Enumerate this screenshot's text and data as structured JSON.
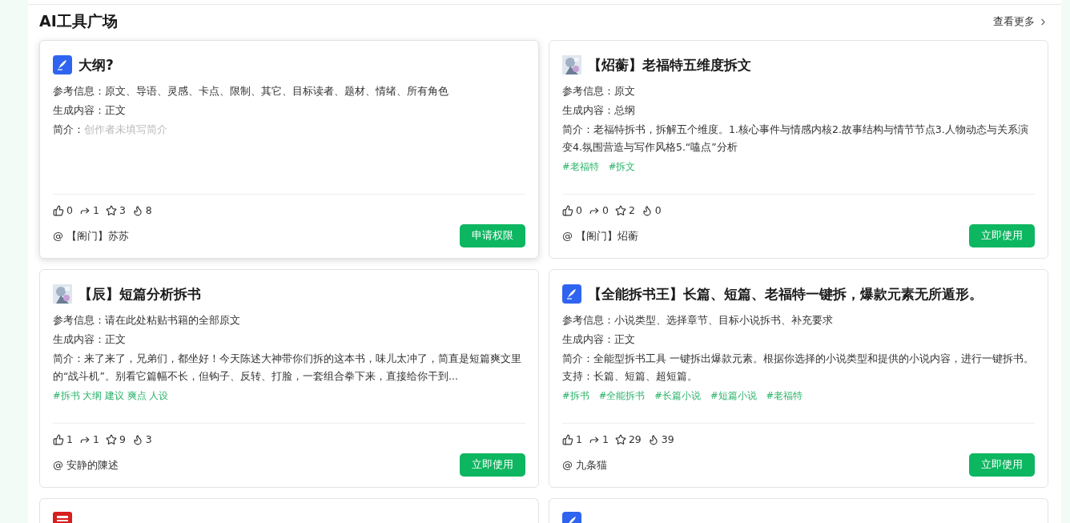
{
  "section": {
    "title": "AI工具广场",
    "more_link": "查看更多"
  },
  "cards": [
    {
      "kind": "quill",
      "raised": true,
      "title": "大纲?",
      "fields": [
        {
          "label": "参考信息：",
          "value": "原文、导语、灵感、卡点、限制、其它、目标读者、题材、情绪、所有角色",
          "empty": false
        },
        {
          "label": "生成内容：",
          "value": "正文",
          "empty": false
        },
        {
          "label": "简介：",
          "value": "创作者未填写简介",
          "empty": true
        }
      ],
      "stats": {
        "likes": "0",
        "shares": "1",
        "stars": "3",
        "heat": "8"
      },
      "author": "@ 【阁门】苏苏",
      "button": "申请权限"
    },
    {
      "kind": "avatar",
      "raised": false,
      "title": "【炤蘅】老福特五维度拆文",
      "fields": [
        {
          "label": "参考信息：",
          "value": "原文",
          "empty": false
        },
        {
          "label": "生成内容：",
          "value": "总纲",
          "empty": false
        },
        {
          "label": "简介：",
          "value": "老福特拆书，拆解五个维度。1.核心事件与情感内核2.故事结构与情节节点3.人物动态与关系演变4.氛围营造与写作风格5.“嗑点”分析",
          "empty": false
        }
      ],
      "tags": [
        "#老福特",
        "#拆文"
      ],
      "stats": {
        "likes": "0",
        "shares": "0",
        "stars": "2",
        "heat": "0"
      },
      "author": "@ 【阁门】炤蘅",
      "button": "立即使用"
    },
    {
      "kind": "avatar",
      "raised": false,
      "title": "【辰】短篇分析拆书",
      "fields": [
        {
          "label": "参考信息：",
          "value": "请在此处粘贴书籍的全部原文",
          "empty": false
        },
        {
          "label": "生成内容：",
          "value": "正文",
          "empty": false
        },
        {
          "label": "简介：",
          "value": "来了来了，兄弟们，都坐好！今天陈述大神带你们拆的这本书，味儿太冲了，简直是短篇爽文里的“战斗机”。别看它篇幅不长，但钩子、反转、打脸，一套组合拳下来，直接给你干到...",
          "empty": false
        }
      ],
      "tags": [
        "#拆书 大纲 建议 爽点 人设"
      ],
      "stats": {
        "likes": "1",
        "shares": "1",
        "stars": "9",
        "heat": "3"
      },
      "author": "@ 安静的陳述",
      "button": "立即使用"
    },
    {
      "kind": "quill",
      "raised": false,
      "title": "【全能拆书王】长篇、短篇、老福特一键拆，爆款元素无所遁形。",
      "fields": [
        {
          "label": "参考信息：",
          "value": "小说类型、选择章节、目标小说拆书、补充要求",
          "empty": false
        },
        {
          "label": "生成内容：",
          "value": "正文",
          "empty": false
        },
        {
          "label": "简介：",
          "value": "全能型拆书工具 一键拆出爆款元素。根据你选择的小说类型和提供的小说内容，进行一键拆书。支持：长篇、短篇、超短篇。",
          "empty": false
        }
      ],
      "tags": [
        "#拆书",
        "#全能拆书",
        "#长篇小说",
        "#短篇小说",
        "#老福特"
      ],
      "stats": {
        "likes": "1",
        "shares": "1",
        "stars": "29",
        "heat": "39"
      },
      "author": "@ 九条猫",
      "button": "立即使用"
    }
  ],
  "partial_cards": [
    {
      "kind": "book"
    },
    {
      "kind": "quill"
    }
  ]
}
